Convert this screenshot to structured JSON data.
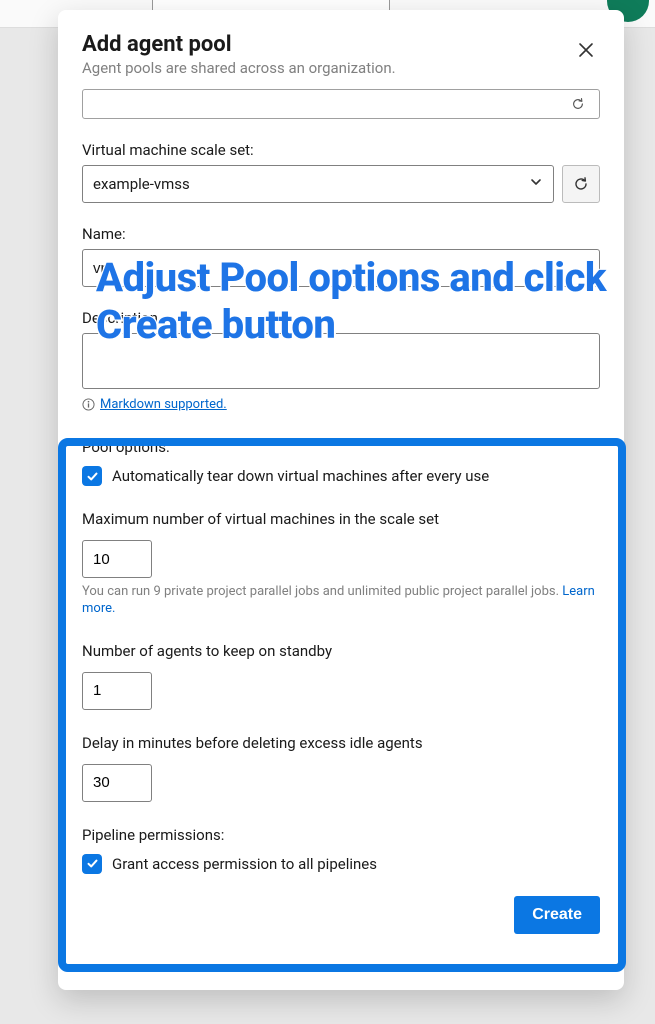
{
  "dialog": {
    "title": "Add agent pool",
    "subtitle": "Agent pools are shared across an organization."
  },
  "cutoff": {
    "text": ""
  },
  "vmss": {
    "label": "Virtual machine scale set:",
    "value": "example-vmss"
  },
  "name": {
    "label": "Name:",
    "value": "vm"
  },
  "description": {
    "label": "Description",
    "markdown_text": "Markdown supported."
  },
  "pool": {
    "section_label": "Pool options:",
    "teardown_label": "Automatically tear down virtual machines after every use",
    "max_vm_label": "Maximum number of virtual machines in the scale set",
    "max_vm_value": "10",
    "max_vm_help": "You can run 9 private project parallel jobs and unlimited public project parallel jobs. ",
    "learn_more": "Learn more.",
    "standby_label": "Number of agents to keep on standby",
    "standby_value": "1",
    "delay_label": "Delay in minutes before deleting excess idle agents",
    "delay_value": "30"
  },
  "pipeline": {
    "section_label": "Pipeline permissions:",
    "grant_label": "Grant access permission to all pipelines"
  },
  "footer": {
    "create_label": "Create"
  },
  "annotation": {
    "text": "Adjust Pool options and click Create button"
  }
}
